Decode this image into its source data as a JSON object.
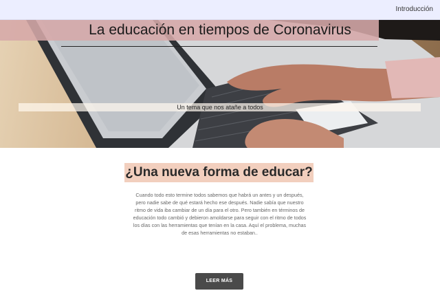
{
  "nav": {
    "link_label": "Introducción"
  },
  "hero": {
    "title": "La educación en tiempos de Coronavirus",
    "subtitle": "Un tema que nos atañe a todos"
  },
  "section": {
    "heading": "¿Una nueva forma de educar?",
    "body": "Cuando todo esto termine todos sabemos que habrá un antes y un después, pero nadie sabe de qué estará hecho ese después. Nadie sabía que nuestro ritmo de vida iba cambiar de un día para el otro. Pero también en términos de educación todo cambió y debieron amoldarse para seguir con el ritmo de todos los días con las herramientas que tenían en la casa. Aquí el problema, muchas de esas herramientas no estaban..",
    "button_label": "LEER MÁS"
  }
}
